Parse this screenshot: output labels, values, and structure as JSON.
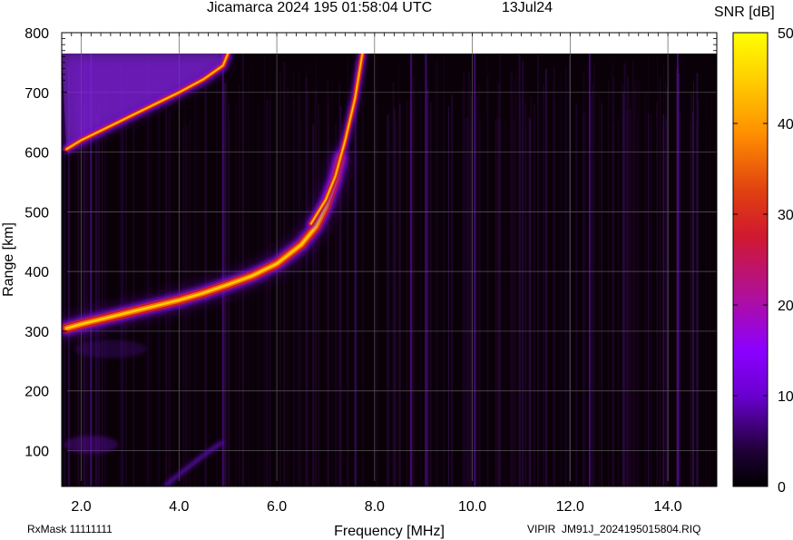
{
  "header": {
    "title": "Jicamarca 2024 195 01:58:04 UTC",
    "date": "13Jul24"
  },
  "footer": {
    "rxmask": "RxMask 11111111",
    "file": "VIPIR  JM91J_2024195015804.RIQ"
  },
  "colors": {
    "background": "#0a0008",
    "grid": "#5a5a5a",
    "trace_core": "#ffd000",
    "trace_mid": "#ff6a00",
    "trace_outer": "#c01a30",
    "halo": "#7a10e0",
    "interference": "#6a10c0"
  },
  "chart_data": {
    "type": "heatmap",
    "title": "Jicamarca 2024 195 01:58:04 UTC",
    "xlabel": "Frequency [MHz]",
    "ylabel": "Range [km]",
    "xlim": [
      1.6,
      15.0
    ],
    "ylim": [
      40,
      800
    ],
    "data_ymax": 765,
    "grid": true,
    "x_ticks": [
      2.0,
      4.0,
      6.0,
      8.0,
      10.0,
      12.0,
      14.0
    ],
    "x_tick_labels": [
      "2.0",
      "4.0",
      "6.0",
      "8.0",
      "10.0",
      "12.0",
      "14.0"
    ],
    "y_ticks": [
      100,
      200,
      300,
      400,
      500,
      600,
      700,
      800
    ],
    "y_tick_labels": [
      "100",
      "200",
      "300",
      "400",
      "500",
      "600",
      "700",
      "800"
    ],
    "colorbar": {
      "label": "SNR [dB]",
      "min": 0,
      "max": 50,
      "ticks": [
        0,
        10,
        20,
        30,
        40,
        50
      ],
      "tick_labels": [
        "0",
        "10",
        "20",
        "30",
        "40",
        "50"
      ],
      "stops": [
        "#000000",
        "#2a0040",
        "#7a00ff",
        "#b02090",
        "#e02020",
        "#ff8c00",
        "#ffd800",
        "#ffff00"
      ]
    },
    "series": [
      {
        "trace": "o-mode",
        "points": [
          [
            1.7,
            305
          ],
          [
            2.0,
            312
          ],
          [
            2.5,
            322
          ],
          [
            3.0,
            332
          ],
          [
            3.5,
            342
          ],
          [
            4.0,
            352
          ],
          [
            4.5,
            364
          ],
          [
            5.0,
            378
          ],
          [
            5.5,
            393
          ],
          [
            6.0,
            413
          ],
          [
            6.5,
            445
          ],
          [
            6.8,
            475
          ],
          [
            7.0,
            508
          ],
          [
            7.2,
            555
          ],
          [
            7.3,
            590
          ]
        ]
      },
      {
        "trace": "x-mode",
        "points": [
          [
            6.7,
            480
          ],
          [
            7.0,
            520
          ],
          [
            7.2,
            560
          ],
          [
            7.4,
            620
          ],
          [
            7.6,
            690
          ],
          [
            7.75,
            765
          ]
        ]
      },
      {
        "trace": "multihop",
        "points": [
          [
            1.7,
            605
          ],
          [
            2.0,
            620
          ],
          [
            2.5,
            640
          ],
          [
            3.0,
            660
          ],
          [
            3.5,
            680
          ],
          [
            4.0,
            700
          ],
          [
            4.5,
            722
          ],
          [
            4.9,
            745
          ],
          [
            5.0,
            765
          ]
        ]
      },
      {
        "trace": "low-range-echo",
        "points": [
          [
            3.7,
            40
          ],
          [
            4.0,
            60
          ],
          [
            4.5,
            92
          ],
          [
            4.9,
            115
          ]
        ]
      }
    ]
  }
}
